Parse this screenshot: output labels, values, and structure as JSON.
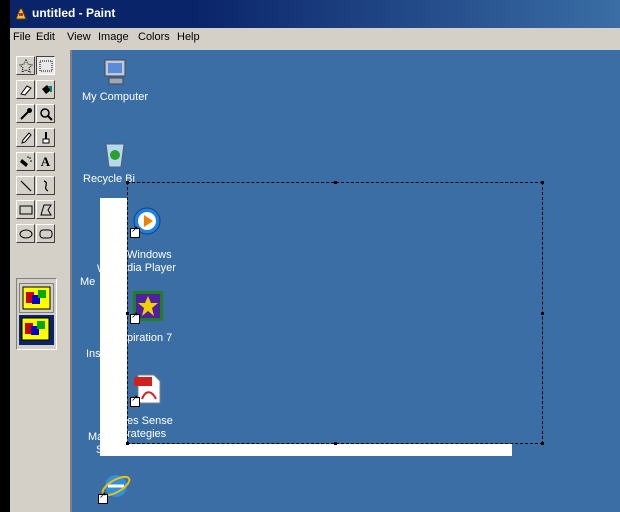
{
  "window": {
    "title": "untitled - Paint"
  },
  "menu": [
    "File",
    "Edit",
    "View",
    "Image",
    "Colors",
    "Help"
  ],
  "tools": [
    {
      "name": "free-form-select-icon",
      "glyph": "☆"
    },
    {
      "name": "rectangle-select-icon",
      "glyph": ""
    },
    {
      "name": "eraser-icon",
      "glyph": "⌫"
    },
    {
      "name": "fill-bucket-icon",
      "glyph": "◈"
    },
    {
      "name": "color-picker-icon",
      "glyph": "✎"
    },
    {
      "name": "magnifier-icon",
      "glyph": "🔍"
    },
    {
      "name": "pencil-icon",
      "glyph": "✏"
    },
    {
      "name": "brush-icon",
      "glyph": "♙"
    },
    {
      "name": "airbrush-icon",
      "glyph": "✈"
    },
    {
      "name": "text-tool-icon",
      "glyph": "A"
    },
    {
      "name": "line-icon",
      "glyph": "╲"
    },
    {
      "name": "curve-icon",
      "glyph": "∫"
    },
    {
      "name": "rectangle-icon",
      "glyph": "▭"
    },
    {
      "name": "polygon-icon",
      "glyph": "⏢"
    },
    {
      "name": "ellipse-icon",
      "glyph": "⬭"
    },
    {
      "name": "rounded-rectangle-icon",
      "glyph": "▢"
    }
  ],
  "desktop_icons": [
    {
      "label": "My Computer",
      "icon": "my-computer-icon"
    },
    {
      "label": "Recycle Bin",
      "icon": "recycle-bin-icon"
    },
    {
      "label": "Windows Media Player",
      "icon": "media-player-icon"
    },
    {
      "label": "Inspiration 7",
      "icon": "inspiration-icon"
    },
    {
      "label": "Makes Sense Strategies",
      "icon": "pdf-icon"
    },
    {
      "label": "",
      "icon": "internet-explorer-icon"
    }
  ],
  "visible_fragments": {
    "recycle": "Recycle Bi",
    "wmp_left_1": "W",
    "wmp_left_2": "Me",
    "insp_left": "Insp",
    "makes_left_1": "Mak",
    "makes_left_2": "St"
  },
  "pasted_labels": {
    "wmp_1": "Windows",
    "wmp_2": "dia Player",
    "insp": "piration 7",
    "makes_1": "es Sense",
    "makes_2": "rategies"
  },
  "colors": {
    "desktop": "#3a6ea5",
    "titlebar": "#0a246a",
    "chrome": "#d4d0c8"
  }
}
